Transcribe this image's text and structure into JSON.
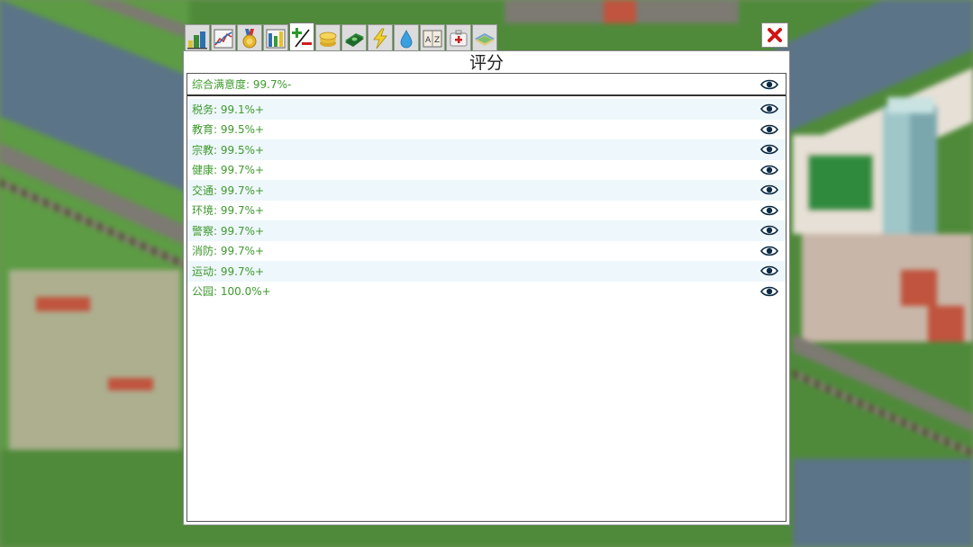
{
  "panel": {
    "title": "评分",
    "close_icon": "close-x-icon",
    "accent_color": "#3d9a2c",
    "close_color": "#d01515"
  },
  "tabs": [
    {
      "icon": "city-buildings-icon",
      "active": false
    },
    {
      "icon": "line-graph-icon",
      "active": false
    },
    {
      "icon": "medal-icon",
      "active": false
    },
    {
      "icon": "bar-graph-icon",
      "active": false
    },
    {
      "icon": "plus-minus-icon",
      "active": true
    },
    {
      "icon": "coins-icon",
      "active": false
    },
    {
      "icon": "money-bill-icon",
      "active": false
    },
    {
      "icon": "lightning-icon",
      "active": false
    },
    {
      "icon": "water-drop-icon",
      "active": false
    },
    {
      "icon": "az-book-icon",
      "active": false
    },
    {
      "icon": "first-aid-icon",
      "active": false
    },
    {
      "icon": "map-book-icon",
      "active": false
    }
  ],
  "overall": {
    "label": "综合满意度: 99.7%-"
  },
  "ratings": [
    {
      "label": "税务: 99.1%+"
    },
    {
      "label": "教育: 99.5%+"
    },
    {
      "label": "宗教: 99.5%+"
    },
    {
      "label": "健康: 99.7%+"
    },
    {
      "label": "交通: 99.7%+"
    },
    {
      "label": "环境: 99.7%+"
    },
    {
      "label": "警察: 99.7%+"
    },
    {
      "label": "消防: 99.7%+"
    },
    {
      "label": "运动: 99.7%+"
    },
    {
      "label": "公园: 100.0%+"
    }
  ]
}
